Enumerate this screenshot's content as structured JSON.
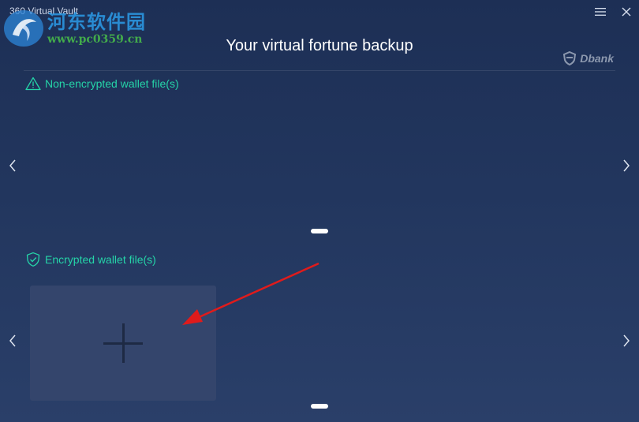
{
  "window": {
    "app_title": "360 Virtual Vault",
    "menu_icon": "hamburger-menu-icon",
    "close_icon": "close-icon"
  },
  "watermark": {
    "cn_text": "河东软件园",
    "url_text": "www.pc0359.cn"
  },
  "header": {
    "title": "Your virtual fortune backup",
    "brand": "Dbank",
    "brand_icon": "dbank-shield-icon"
  },
  "sections": {
    "non_encrypted": {
      "label": "Non-encrypted wallet file(s)",
      "icon": "warning-triangle-icon"
    },
    "encrypted": {
      "label": "Encrypted wallet file(s)",
      "icon": "shield-check-icon",
      "add_card_icon": "plus-icon"
    }
  },
  "colors": {
    "accent": "#25d4a8",
    "background_top": "#1d2f55",
    "background_bottom": "#2a3f69",
    "card": "#34456c",
    "annotation_arrow": "#e01b1b"
  }
}
